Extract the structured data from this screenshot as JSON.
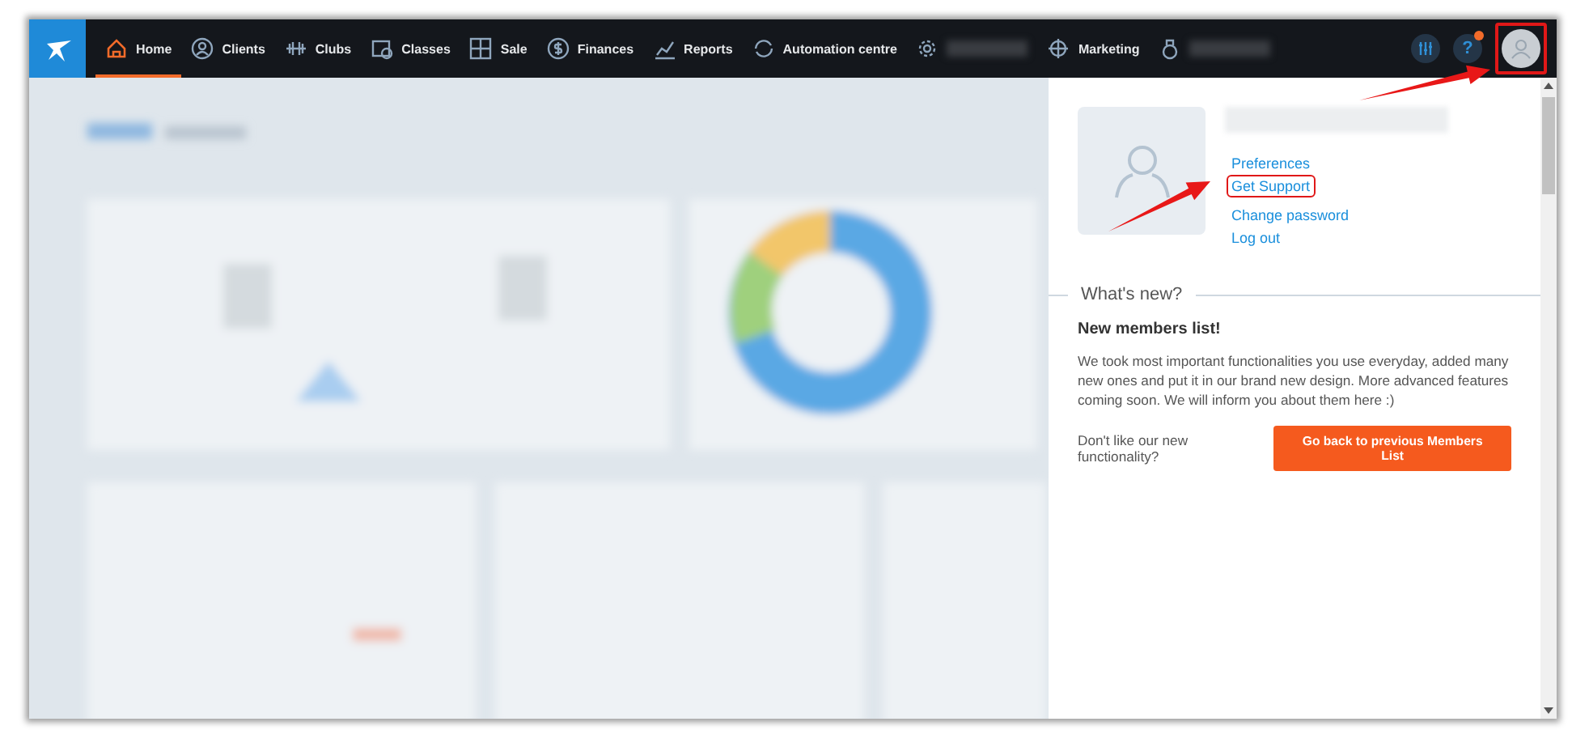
{
  "nav": {
    "items": [
      {
        "kind": "link",
        "label": "Home",
        "selected": true
      },
      {
        "kind": "link",
        "label": "Clients",
        "selected": false
      },
      {
        "kind": "link",
        "label": "Clubs",
        "selected": false
      },
      {
        "kind": "link",
        "label": "Classes",
        "selected": false
      },
      {
        "kind": "link",
        "label": "Sale",
        "selected": false
      },
      {
        "kind": "link",
        "label": "Finances",
        "selected": false
      },
      {
        "kind": "link",
        "label": "Reports",
        "selected": false
      },
      {
        "kind": "link",
        "label": "Automation centre",
        "selected": false
      },
      {
        "kind": "redacted",
        "selected": false
      },
      {
        "kind": "link",
        "label": "Marketing",
        "selected": false
      },
      {
        "kind": "redacted",
        "selected": false
      }
    ],
    "help": {
      "label": "?",
      "notification": true
    },
    "profile_highlighted": true
  },
  "profile_panel": {
    "links": [
      {
        "label": "Preferences",
        "highlighted": false
      },
      {
        "label": "Get Support",
        "highlighted": true
      },
      {
        "label": "Change password",
        "highlighted": false
      },
      {
        "label": "Log out",
        "highlighted": false
      }
    ],
    "whats_new": {
      "title": "What's new?",
      "heading": "New members list!",
      "body": "We took most important functionalities you use everyday, added many new ones and put it in our brand new design. More advanced features coming soon. We will inform you about them here :)",
      "prompt": "Don't like our new functionality?",
      "button": "Go back to previous Members List"
    }
  },
  "annotations": [
    {
      "kind": "arrow"
    },
    {
      "kind": "arrow"
    }
  ]
}
